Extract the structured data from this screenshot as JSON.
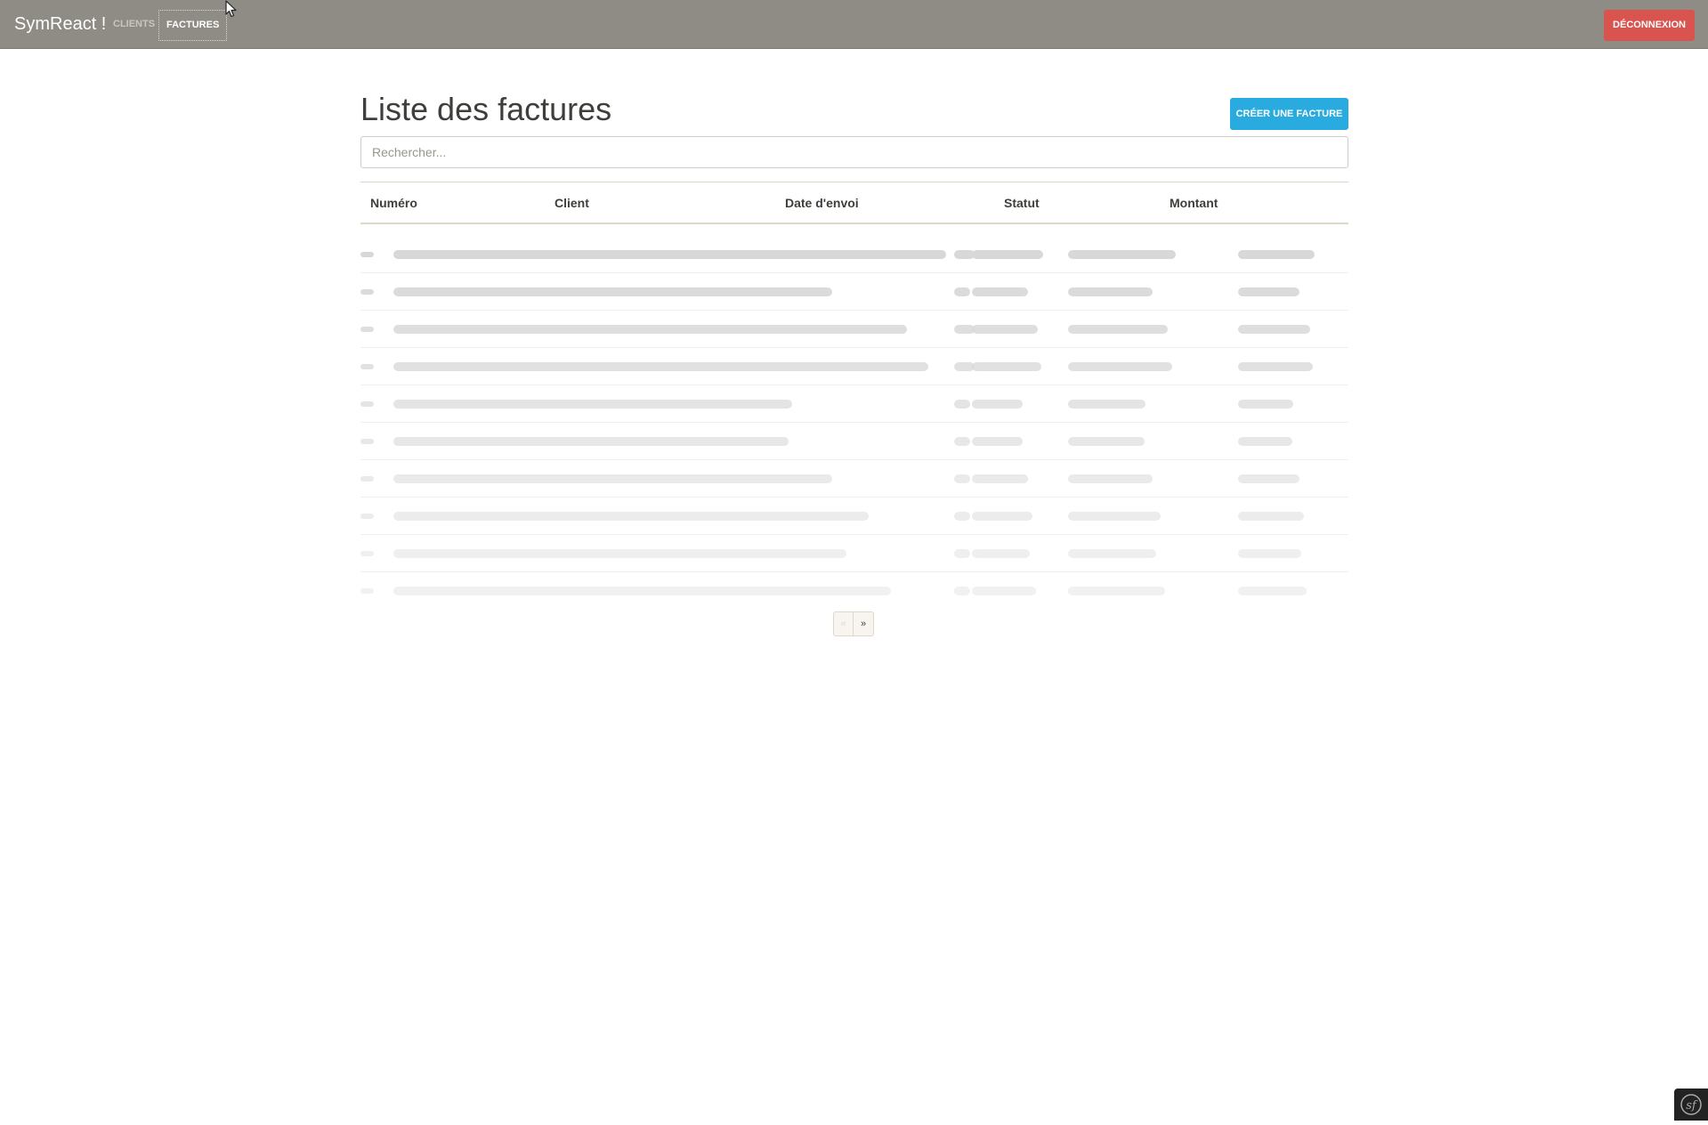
{
  "navbar": {
    "brand": "SymReact !",
    "links": [
      {
        "label": "CLIENTS",
        "active": false
      },
      {
        "label": "FACTURES",
        "active": true
      }
    ],
    "logout_label": "DÉCONNEXION",
    "background_color": "#8e8c84",
    "logout_color": "#d9534f"
  },
  "main": {
    "title": "Liste des factures",
    "create_button_label": "CRÉER UNE FACTURE",
    "create_button_color": "#29abe0",
    "search": {
      "placeholder": "Rechercher...",
      "value": ""
    },
    "table": {
      "columns": [
        "Numéro",
        "Client",
        "Date d'envoi",
        "Statut",
        "Montant"
      ],
      "loading": true,
      "skeleton_row_count": 10
    },
    "pagination": {
      "prev_label": "«",
      "next_label": "»"
    }
  },
  "icons": {
    "cursor": "mouse-pointer-icon",
    "symfony": "symfony-logo-icon"
  }
}
